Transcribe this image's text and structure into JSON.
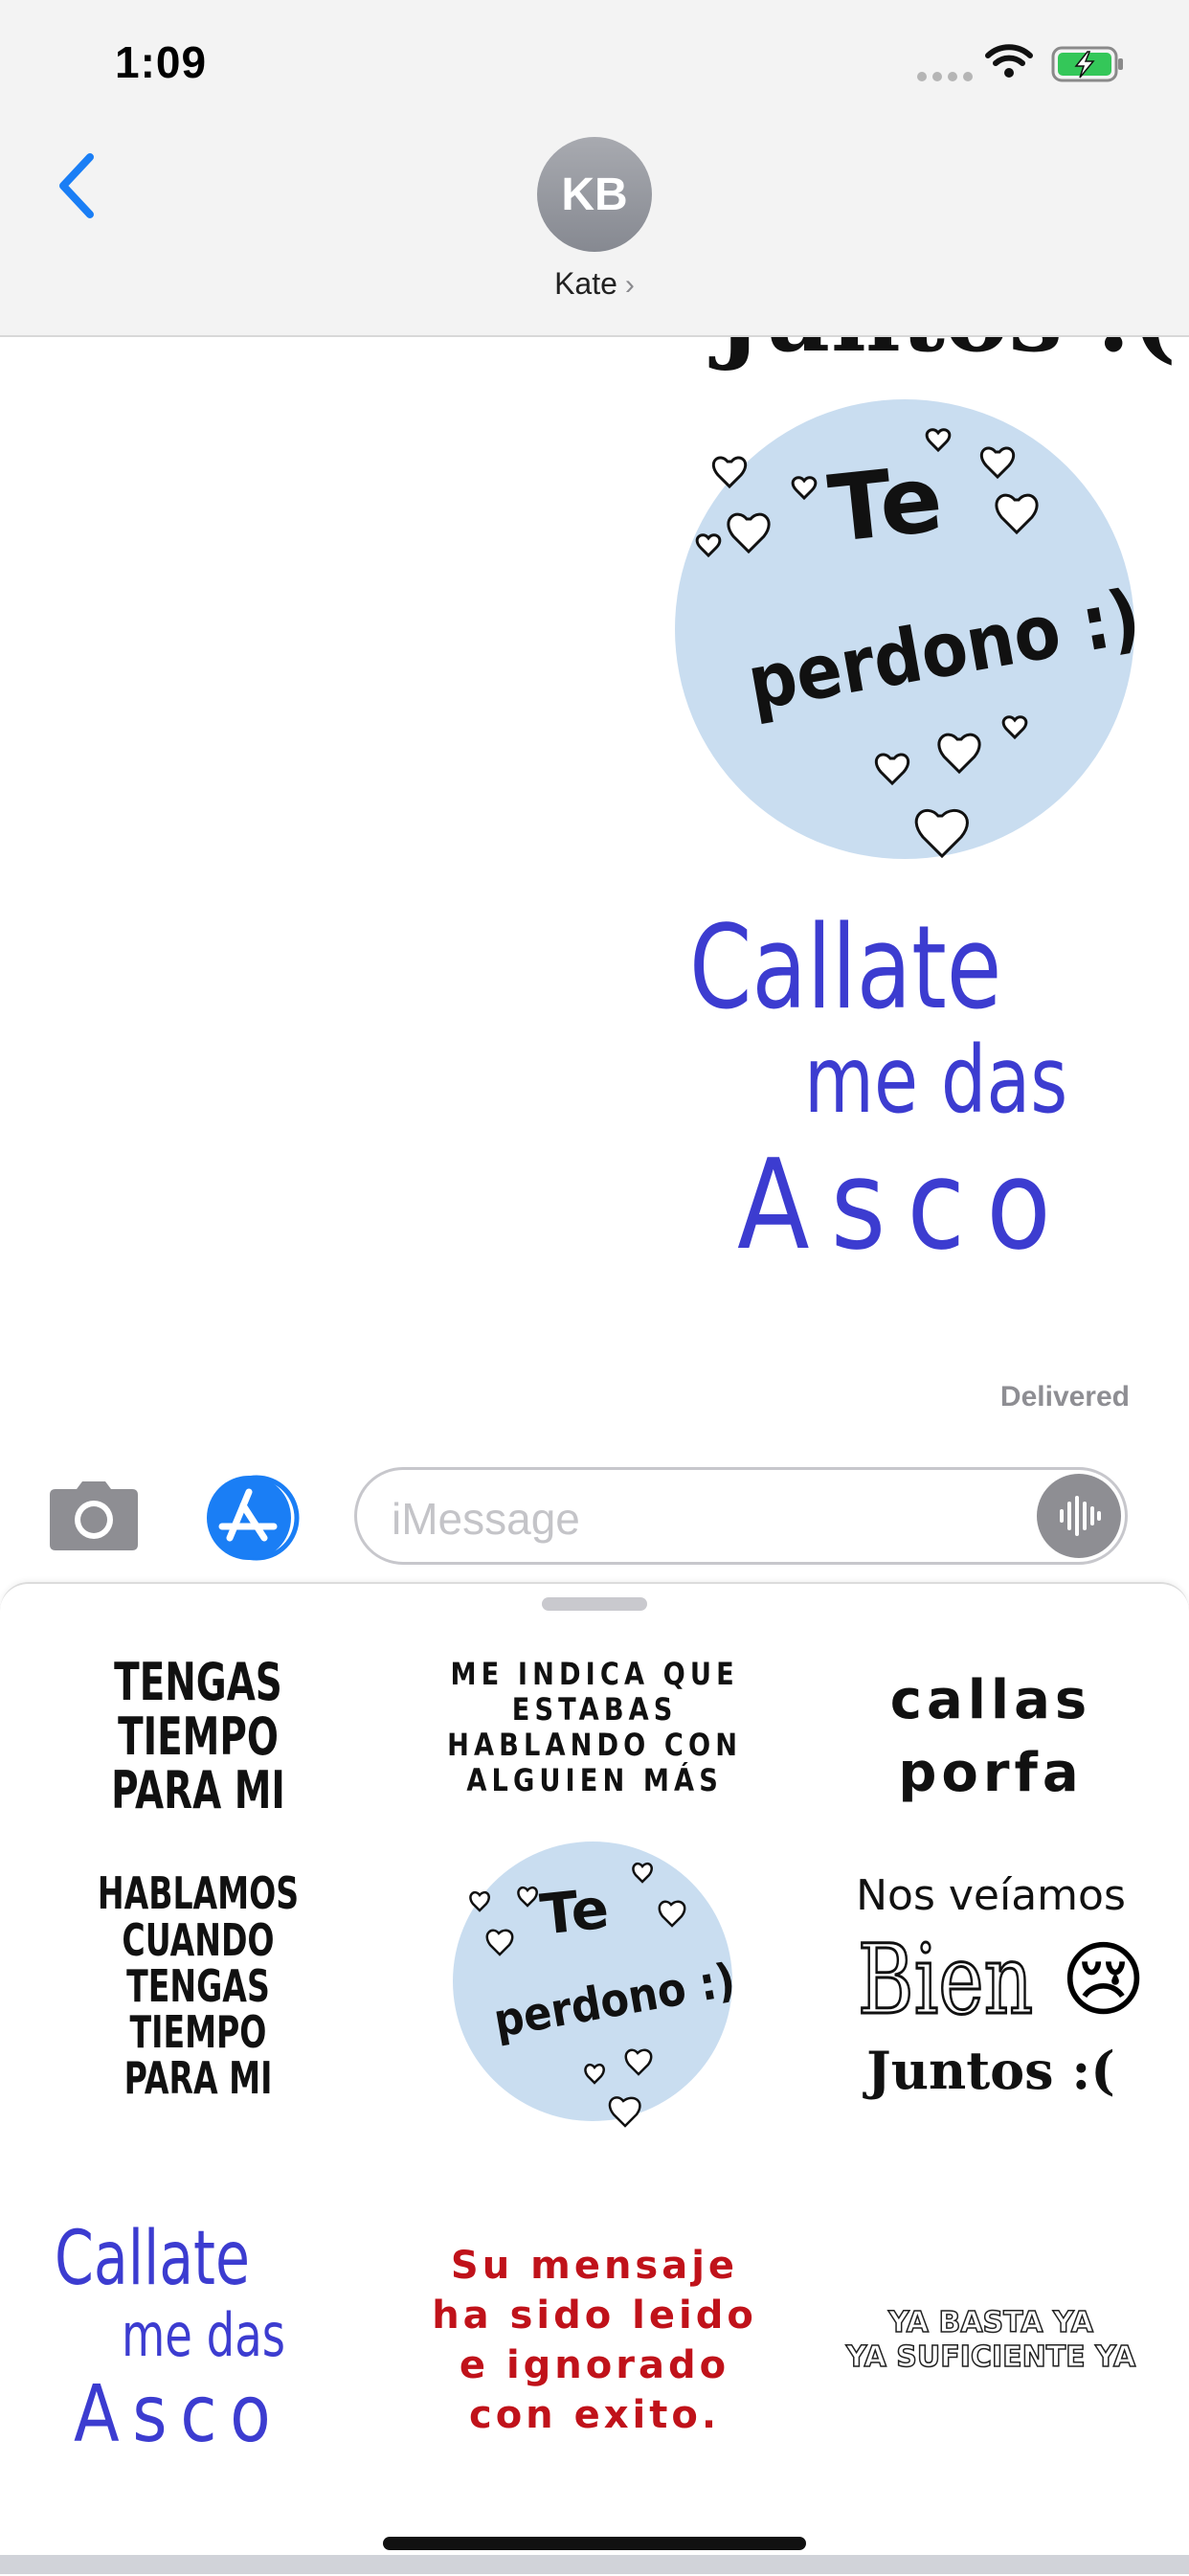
{
  "status_bar": {
    "time": "1:09"
  },
  "header": {
    "avatar_initials": "KB",
    "contact_name": "Kate"
  },
  "conversation": {
    "partial_sticker_text": "Juntos :(",
    "sticker_te_perdono": {
      "line1": "Te",
      "line2": "perdono :)"
    },
    "sticker_callate": {
      "line1": "Callate",
      "line2": "me das",
      "line3": "Asco"
    },
    "delivered_label": "Delivered"
  },
  "input_bar": {
    "placeholder": "iMessage",
    "value": ""
  },
  "sticker_drawer": {
    "row1": {
      "a": [
        "TENGAS TIEMPO",
        "PARA MI"
      ],
      "b": [
        "ME INDICA QUE",
        "ESTABAS",
        "HABLANDO CON",
        "ALGUIEN MÁS"
      ],
      "c": [
        "callas",
        "porfa"
      ]
    },
    "row2": {
      "a": [
        "HABLAMOS CUANDO",
        "TENGAS TIEMPO",
        "PARA MI"
      ],
      "b": {
        "line1": "Te",
        "line2": "perdono :)"
      },
      "c": {
        "line1": "Nos veíamos",
        "line2": "Bien",
        "emoji": "😢",
        "line3": "Juntos :("
      }
    },
    "row3": {
      "a": {
        "line1": "Callate",
        "line2": "me das",
        "line3": "Asco"
      },
      "b": [
        "Su mensaje",
        "ha sido leido",
        "e ignorado",
        "con exito."
      ],
      "c": [
        "YA BASTA YA",
        "YA SUFICIENTE YA"
      ]
    }
  },
  "colors": {
    "ios_blue": "#1a7ef5",
    "sticker_circle": "#c9ddf0",
    "handwriting_blue": "#3c3cd0",
    "red_text": "#c0121a"
  }
}
